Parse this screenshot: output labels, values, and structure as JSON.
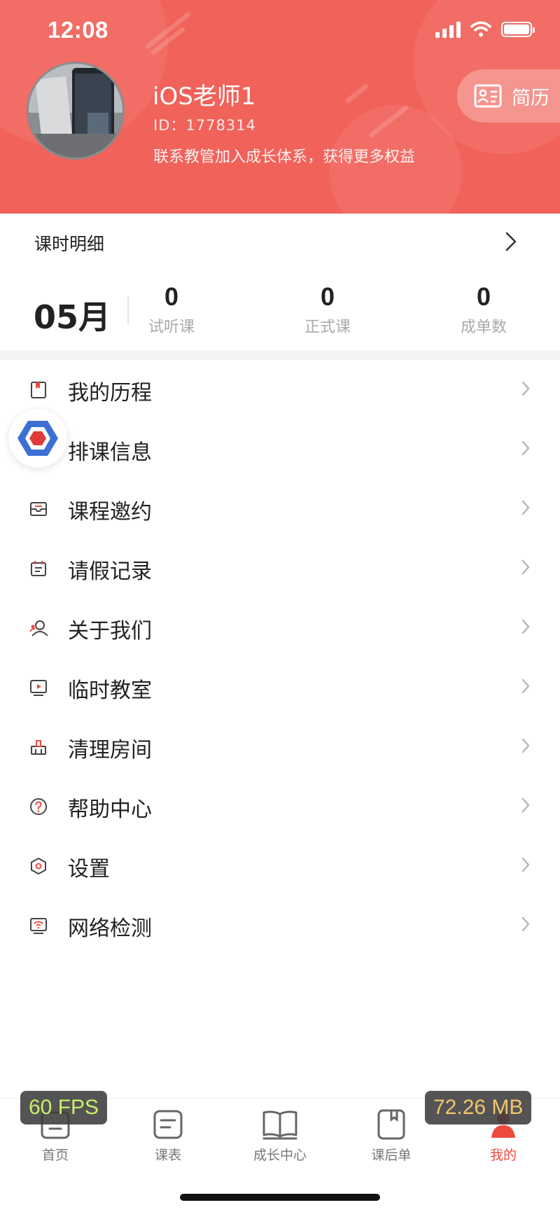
{
  "status_bar": {
    "time": "12:08"
  },
  "profile": {
    "name": "iOS老师1",
    "id_text": "ID：1778314",
    "tip": "联系教管加入成长体系，获得更多权益",
    "resume_label": "简历"
  },
  "stats": {
    "detail_title": "课时明细",
    "month": "05月",
    "items": [
      {
        "value": "0",
        "label": "试听课"
      },
      {
        "value": "0",
        "label": "正式课"
      },
      {
        "value": "0",
        "label": "成单数"
      }
    ]
  },
  "menu": {
    "items": [
      {
        "label": "我的历程",
        "icon": "book-icon"
      },
      {
        "label": "排课信息",
        "icon": "schedule-icon"
      },
      {
        "label": "课程邀约",
        "icon": "inbox-icon"
      },
      {
        "label": "请假记录",
        "icon": "calendar-list-icon"
      },
      {
        "label": "关于我们",
        "icon": "users-icon"
      },
      {
        "label": "临时教室",
        "icon": "video-classroom-icon"
      },
      {
        "label": "清理房间",
        "icon": "broom-icon"
      },
      {
        "label": "帮助中心",
        "icon": "help-icon"
      },
      {
        "label": "设置",
        "icon": "settings-hexagon-icon"
      },
      {
        "label": "网络检测",
        "icon": "network-monitor-icon"
      }
    ]
  },
  "tabbar": {
    "items": [
      {
        "label": "首页",
        "icon": "home-icon"
      },
      {
        "label": "课表",
        "icon": "timetable-icon"
      },
      {
        "label": "成长中心",
        "icon": "open-book-icon"
      },
      {
        "label": "课后单",
        "icon": "homework-icon"
      },
      {
        "label": "我的",
        "icon": "profile-icon"
      }
    ],
    "active_index": 4
  },
  "debug_overlay": {
    "fps": "60 FPS",
    "memory": "72.26 MB"
  },
  "colors": {
    "brand_red": "#f0625a",
    "active_tab": "#ee4a3f",
    "fps_text": "#c8f06a",
    "mem_text": "#f2c66b"
  }
}
